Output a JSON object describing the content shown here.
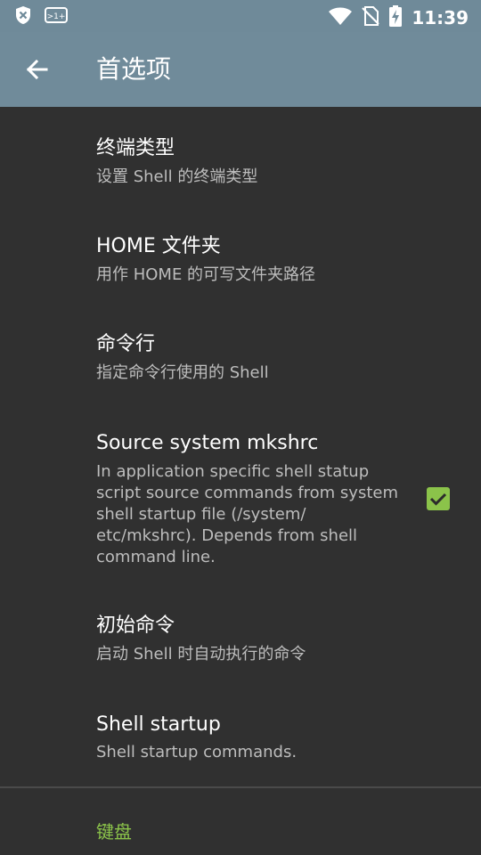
{
  "status_bar": {
    "time": "11:39",
    "left_icons": [
      "shield-icon",
      "notification-badge-icon"
    ],
    "right_icons": [
      "wifi-icon",
      "no-sim-icon",
      "battery-charging-icon"
    ]
  },
  "app_bar": {
    "title": "首选项",
    "back_icon": "arrow-back-icon"
  },
  "preferences": [
    {
      "title": "终端类型",
      "summary": "设置 Shell 的终端类型"
    },
    {
      "title": "HOME 文件夹",
      "summary": "用作 HOME 的可写文件夹路径"
    },
    {
      "title": "命令行",
      "summary": "指定命令行使用的 Shell"
    },
    {
      "title": "Source system mkshrc",
      "summary": "In application specific shell statup script source commands from system shell startup file (/system/ etc/mkshrc). Depends from shell command line.",
      "checked": true
    },
    {
      "title": "初始命令",
      "summary": "启动 Shell 时自动执行的命令"
    },
    {
      "title": "Shell startup",
      "summary": "Shell startup commands."
    }
  ],
  "category": {
    "label": "键盘"
  },
  "colors": {
    "app_bar": "#708b9a",
    "background": "#303030",
    "accent": "#8bc34a",
    "summary_text": "#bdbdbd"
  }
}
